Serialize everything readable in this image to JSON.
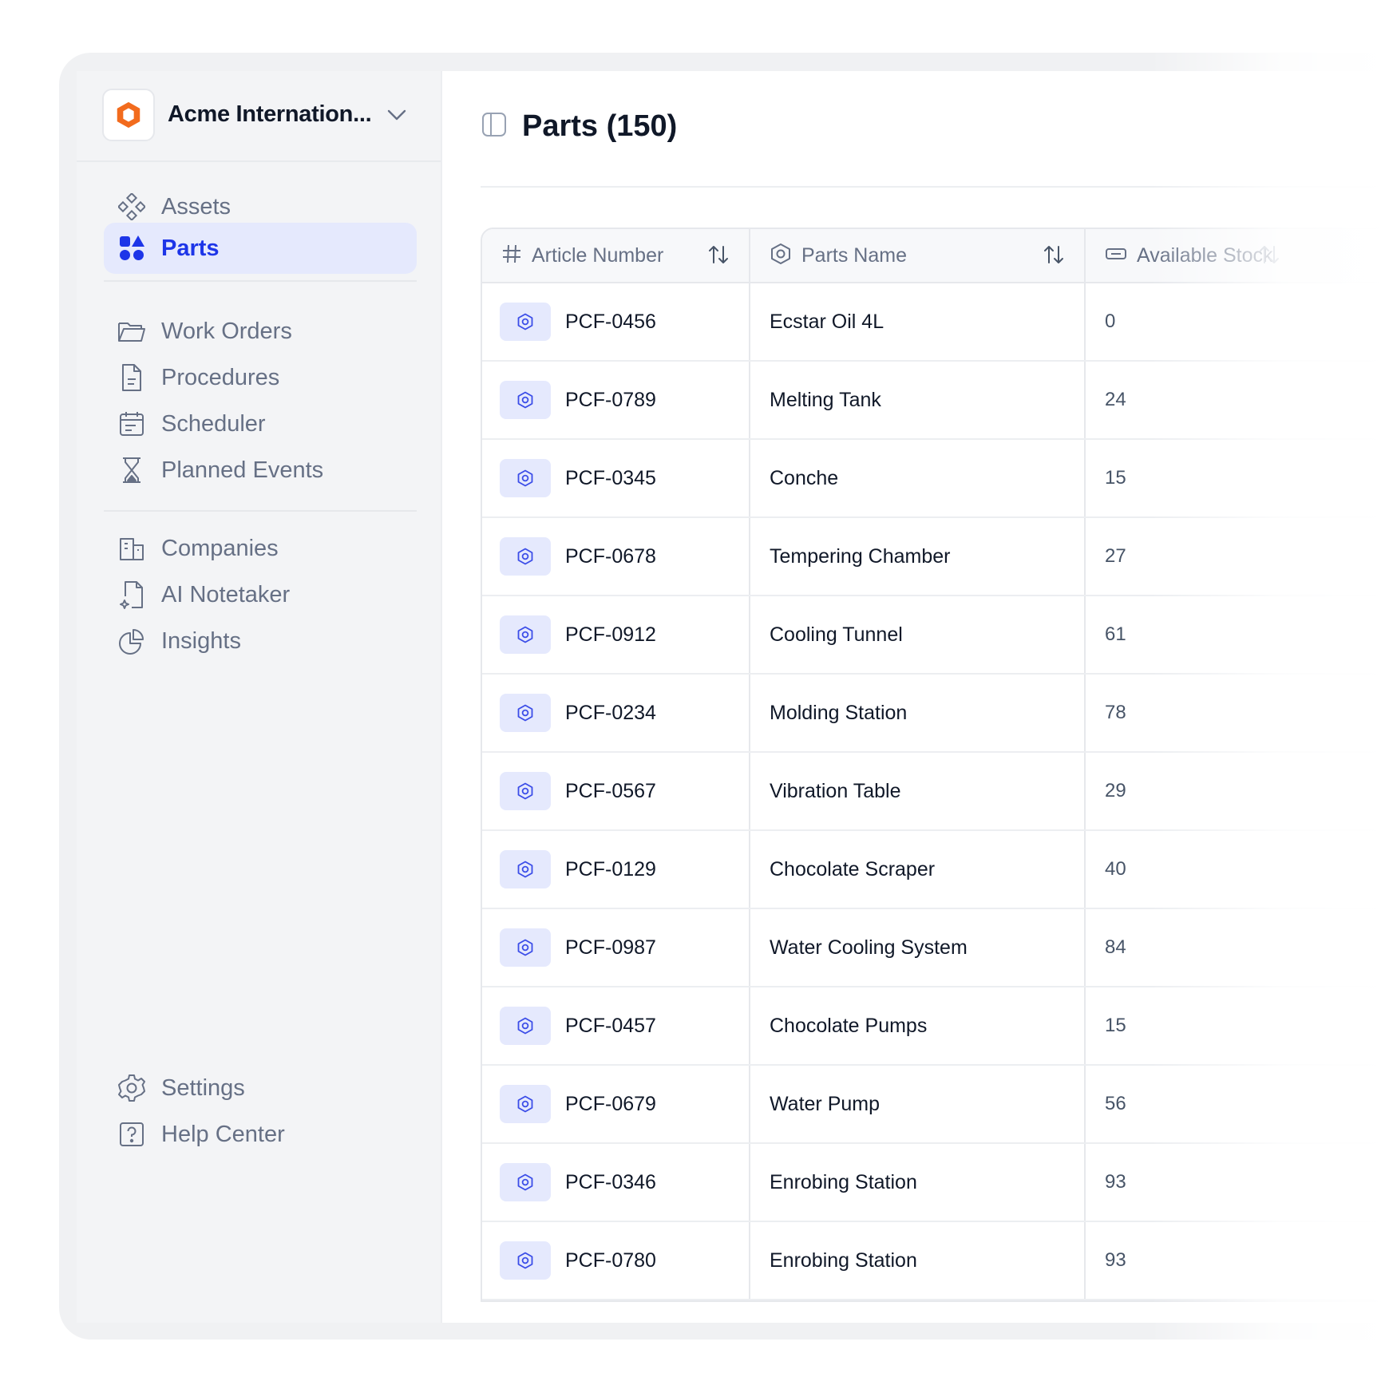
{
  "org": {
    "name": "Acme Internation..."
  },
  "page": {
    "title": "Parts (150)"
  },
  "sidebar": {
    "group1": [
      {
        "label": "Assets",
        "icon": "assets-icon"
      },
      {
        "label": "Parts",
        "icon": "parts-icon",
        "active": true
      }
    ],
    "group2": [
      {
        "label": "Work Orders",
        "icon": "folder-icon"
      },
      {
        "label": "Procedures",
        "icon": "document-icon"
      },
      {
        "label": "Scheduler",
        "icon": "calendar-icon"
      },
      {
        "label": "Planned Events",
        "icon": "hourglass-icon"
      }
    ],
    "group3": [
      {
        "label": "Companies",
        "icon": "building-icon"
      },
      {
        "label": "AI Notetaker",
        "icon": "ai-note-icon"
      },
      {
        "label": "Insights",
        "icon": "pie-chart-icon"
      }
    ],
    "footer": [
      {
        "label": "Settings",
        "icon": "gear-icon"
      },
      {
        "label": "Help Center",
        "icon": "help-icon"
      }
    ]
  },
  "table": {
    "headers": {
      "article_number": "Article Number",
      "parts_name": "Parts Name",
      "available_stock": "Available Stock"
    },
    "rows": [
      {
        "article": "PCF-0456",
        "name": "Ecstar Oil 4L",
        "stock": "0"
      },
      {
        "article": "PCF-0789",
        "name": "Melting Tank",
        "stock": "24"
      },
      {
        "article": "PCF-0345",
        "name": "Conche",
        "stock": "15"
      },
      {
        "article": "PCF-0678",
        "name": "Tempering Chamber",
        "stock": "27"
      },
      {
        "article": "PCF-0912",
        "name": "Cooling Tunnel",
        "stock": "61"
      },
      {
        "article": "PCF-0234",
        "name": "Molding Station",
        "stock": "78"
      },
      {
        "article": "PCF-0567",
        "name": "Vibration Table",
        "stock": "29"
      },
      {
        "article": "PCF-0129",
        "name": "Chocolate Scraper",
        "stock": "40"
      },
      {
        "article": "PCF-0987",
        "name": "Water Cooling System",
        "stock": "84"
      },
      {
        "article": "PCF-0457",
        "name": "Chocolate Pumps",
        "stock": "15"
      },
      {
        "article": "PCF-0679",
        "name": "Water Pump",
        "stock": "56"
      },
      {
        "article": "PCF-0346",
        "name": "Enrobing Station",
        "stock": "93"
      },
      {
        "article": "PCF-0780",
        "name": "Enrobing Station",
        "stock": "93"
      }
    ]
  },
  "colors": {
    "accent": "#1d35e8",
    "brand_orange": "#f26b1d"
  }
}
